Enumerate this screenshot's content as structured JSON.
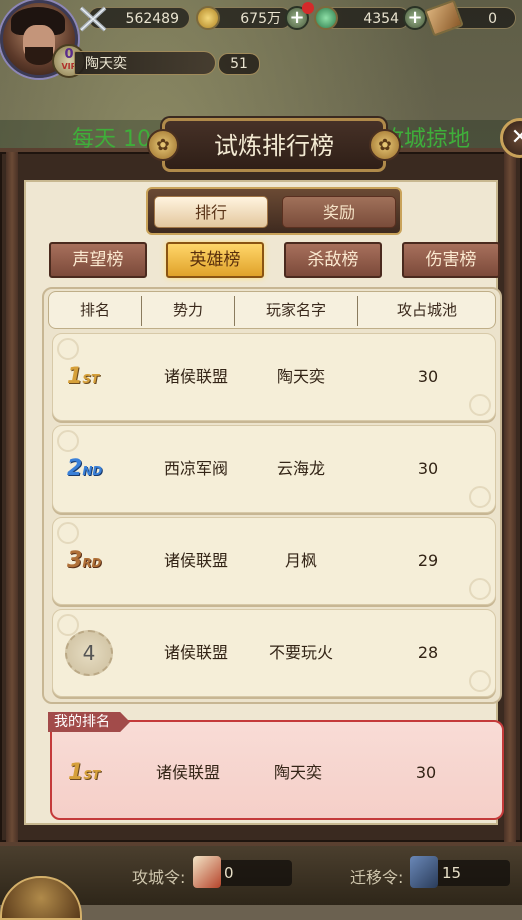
{
  "player": {
    "name": "陶天奕",
    "level": "51",
    "vip_level": "0",
    "vip_label": "VIP"
  },
  "resources": {
    "power": "562489",
    "gold": "675万",
    "jade": "4354",
    "ticket": "0"
  },
  "marquee": {
    "left": "每天 10",
    "right": "攻城掠地"
  },
  "panel": {
    "title": "试炼排行榜",
    "tabs": [
      {
        "label": "排行",
        "active": true
      },
      {
        "label": "奖励",
        "active": false
      }
    ],
    "categories": [
      {
        "label": "声望榜",
        "active": false
      },
      {
        "label": "英雄榜",
        "active": true
      },
      {
        "label": "杀敌榜",
        "active": false
      },
      {
        "label": "伤害榜",
        "active": false
      }
    ],
    "columns": [
      "排名",
      "势力",
      "玩家名字",
      "攻占城池"
    ],
    "rows": [
      {
        "rank": "1",
        "suffix": "ST",
        "faction": "诸侯联盟",
        "player": "陶天奕",
        "cities": "30"
      },
      {
        "rank": "2",
        "suffix": "ND",
        "faction": "西凉军阀",
        "player": "云海龙",
        "cities": "30"
      },
      {
        "rank": "3",
        "suffix": "RD",
        "faction": "诸侯联盟",
        "player": "月枫",
        "cities": "29"
      },
      {
        "rank": "4",
        "suffix": "",
        "faction": "诸侯联盟",
        "player": "不要玩火",
        "cities": "28"
      }
    ],
    "my_rank": {
      "tag": "我的排名",
      "rank": "1",
      "suffix": "ST",
      "faction": "诸侯联盟",
      "player": "陶天奕",
      "cities": "30"
    }
  },
  "bottom": {
    "siege_label": "攻城令:",
    "siege_value": "0",
    "move_label": "迁移令:",
    "move_value": "15"
  },
  "colors": {
    "accent_gold": "#ffd66a",
    "rank_gold": "#d6a03a",
    "rank_blue": "#3a80d8",
    "rank_bronze": "#b07038",
    "my_rank_border": "#c43a3a"
  },
  "icons": [
    "crossed-swords-icon",
    "coin-icon",
    "plus-icon",
    "jade-icon",
    "ticket-icon",
    "close-icon",
    "flower-ornament-icon",
    "siege-token-icon",
    "move-token-icon",
    "back-icon"
  ]
}
